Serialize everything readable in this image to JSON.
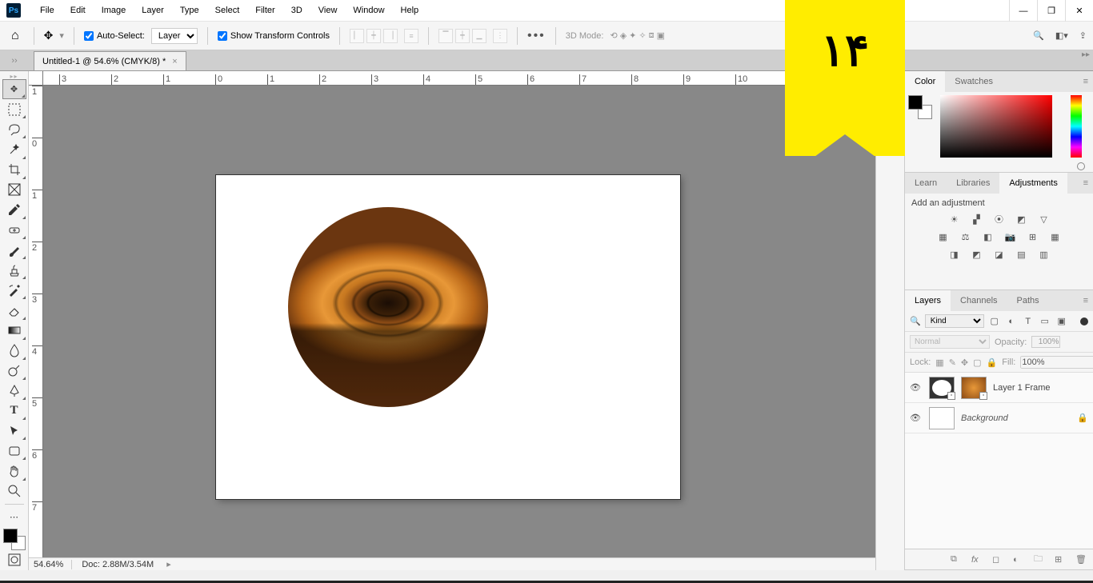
{
  "menubar": {
    "items": [
      "File",
      "Edit",
      "Image",
      "Layer",
      "Type",
      "Select",
      "Filter",
      "3D",
      "View",
      "Window",
      "Help"
    ]
  },
  "optionsbar": {
    "auto_select_label": "Auto-Select:",
    "auto_select_checked": true,
    "auto_select_target": "Layer",
    "show_transform_label": "Show Transform Controls",
    "show_transform_checked": true,
    "mode3d_label": "3D Mode:"
  },
  "document_tab": {
    "title": "Untitled-1 @ 54.6% (CMYK/8) *"
  },
  "ruler": {
    "h_labels": [
      "3",
      "2",
      "1",
      "0",
      "1",
      "2",
      "3",
      "4",
      "5",
      "6",
      "7",
      "8",
      "9",
      "10"
    ],
    "v_labels": [
      "1",
      "0",
      "1",
      "2",
      "3",
      "4",
      "5",
      "6",
      "7"
    ]
  },
  "statusbar": {
    "zoom": "54.64%",
    "docsize": "Doc: 2.88M/3.54M"
  },
  "panels": {
    "color_tabs": [
      "Color",
      "Swatches"
    ],
    "adjust_tabs": [
      "Learn",
      "Libraries",
      "Adjustments"
    ],
    "adjust_label": "Add an adjustment",
    "layers_tabs": [
      "Layers",
      "Channels",
      "Paths"
    ],
    "filter_kind": "Kind",
    "blend_mode": "Normal",
    "opacity_label": "Opacity:",
    "opacity_value": "100%",
    "lock_label": "Lock:",
    "fill_label": "Fill:",
    "fill_value": "100%",
    "layers": [
      {
        "name": "Layer 1 Frame",
        "visible": true,
        "locked": false,
        "has_mask": true,
        "bg": false
      },
      {
        "name": "Background",
        "visible": true,
        "locked": true,
        "has_mask": false,
        "bg": true
      }
    ]
  },
  "bookmark": {
    "text": "۱۴"
  }
}
